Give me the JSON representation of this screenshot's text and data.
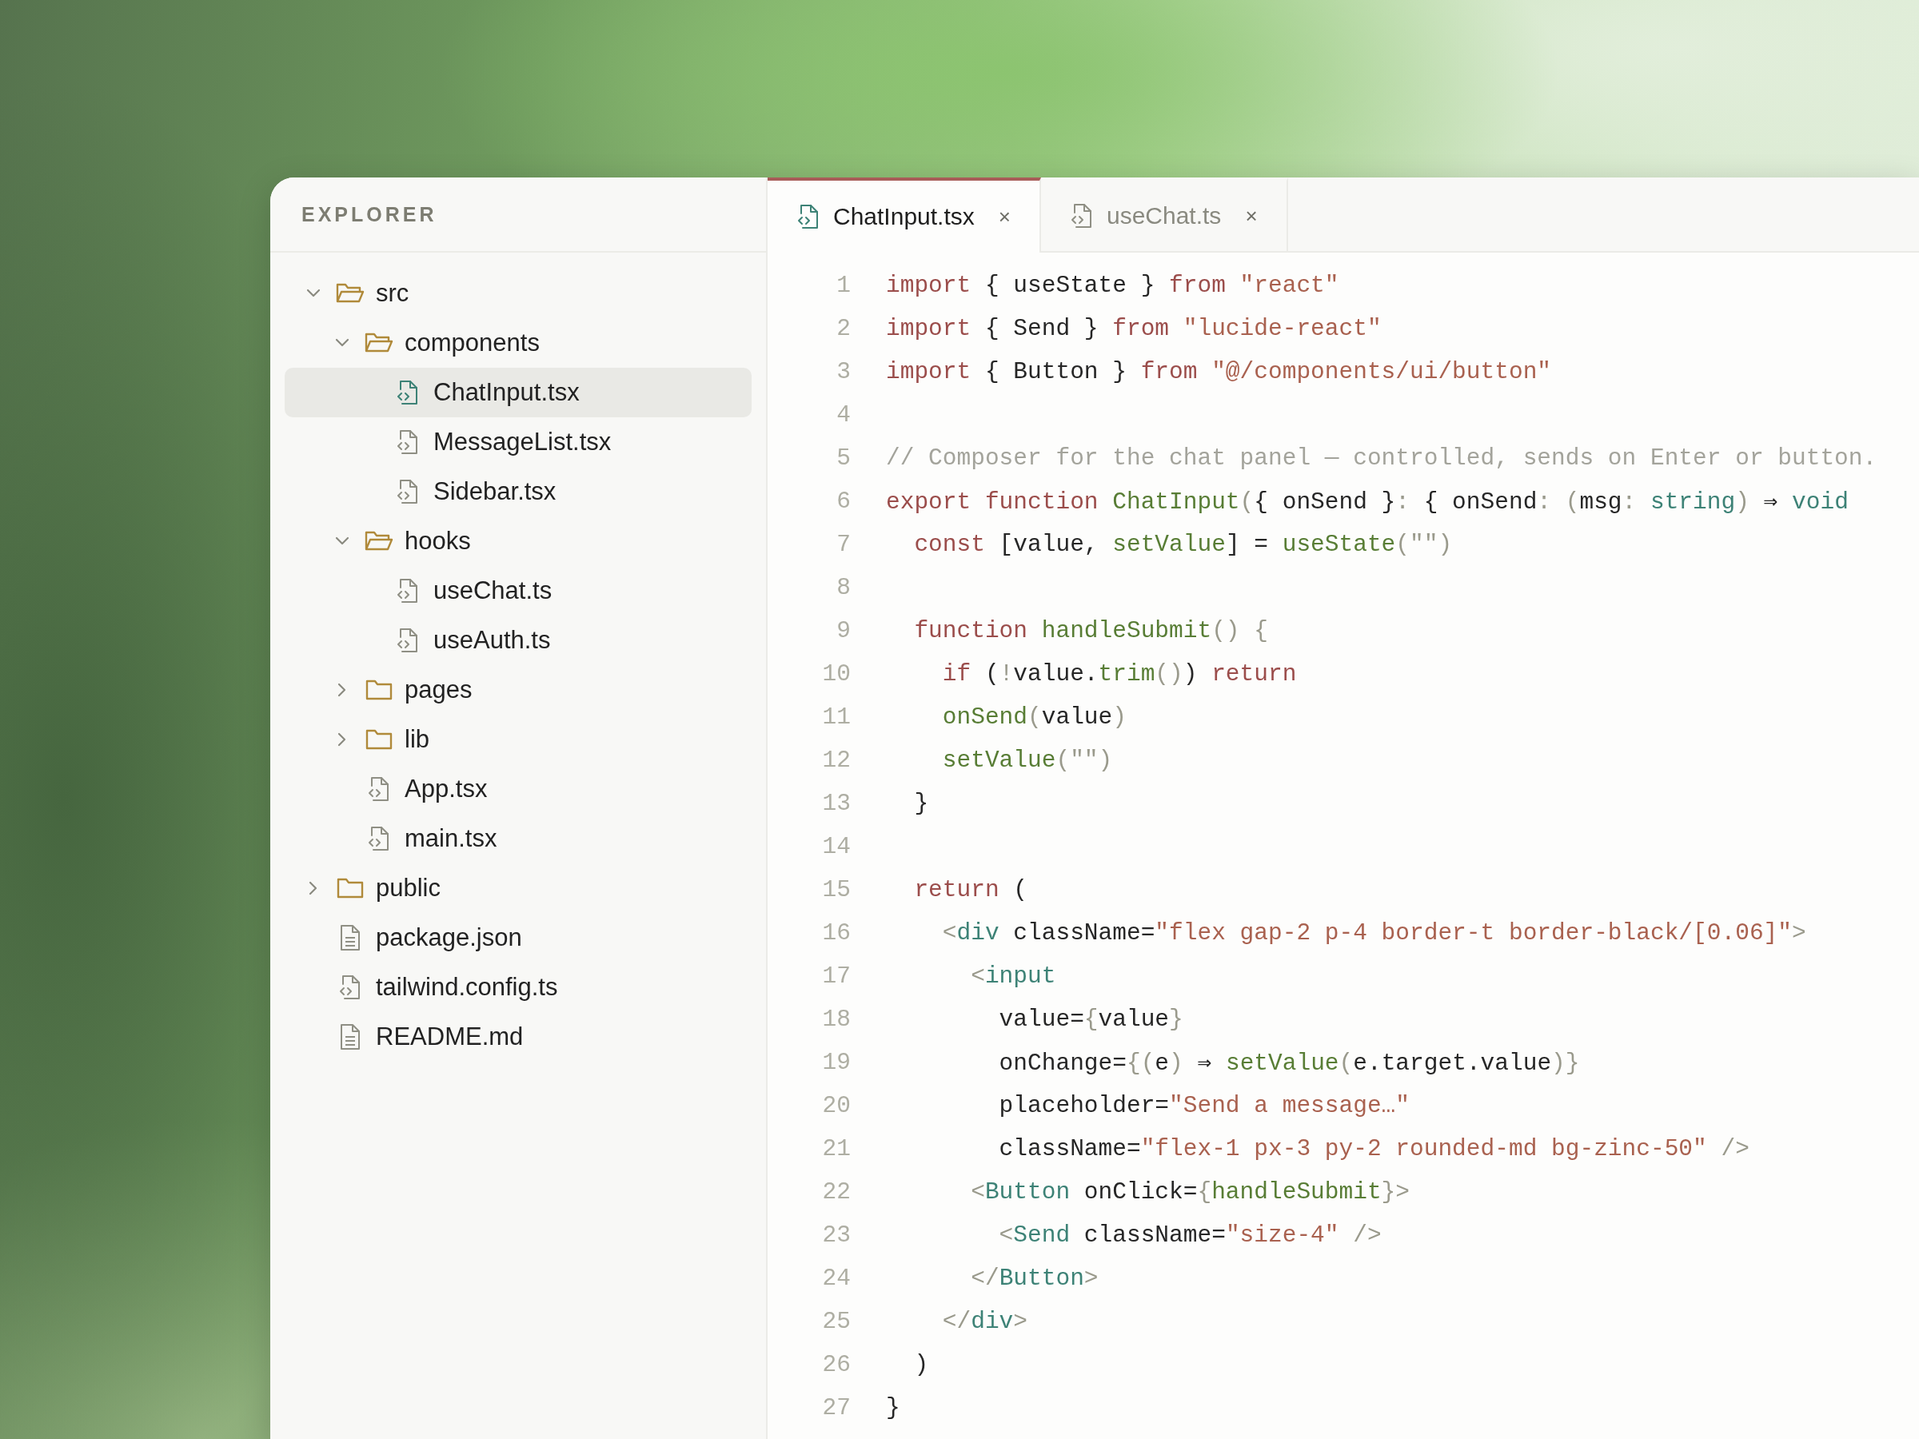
{
  "sidebar": {
    "title": "EXPLORER",
    "tree": [
      {
        "label": "src",
        "kind": "folder",
        "expanded": true,
        "selected": false,
        "children": [
          {
            "label": "components",
            "kind": "folder",
            "expanded": true,
            "selected": false,
            "children": [
              {
                "label": "ChatInput.tsx",
                "kind": "code",
                "selected": true
              },
              {
                "label": "MessageList.tsx",
                "kind": "code",
                "selected": false
              },
              {
                "label": "Sidebar.tsx",
                "kind": "code",
                "selected": false
              }
            ]
          },
          {
            "label": "hooks",
            "kind": "folder",
            "expanded": true,
            "selected": false,
            "children": [
              {
                "label": "useChat.ts",
                "kind": "code",
                "selected": false
              },
              {
                "label": "useAuth.ts",
                "kind": "code",
                "selected": false
              }
            ]
          },
          {
            "label": "pages",
            "kind": "folder",
            "expanded": false,
            "selected": false
          },
          {
            "label": "lib",
            "kind": "folder",
            "expanded": false,
            "selected": false
          },
          {
            "label": "App.tsx",
            "kind": "code",
            "selected": false
          },
          {
            "label": "main.tsx",
            "kind": "code",
            "selected": false
          }
        ]
      },
      {
        "label": "public",
        "kind": "folder",
        "expanded": false,
        "selected": false
      },
      {
        "label": "package.json",
        "kind": "text",
        "selected": false
      },
      {
        "label": "tailwind.config.ts",
        "kind": "code",
        "selected": false
      },
      {
        "label": "README.md",
        "kind": "text",
        "selected": false
      }
    ]
  },
  "tabs": [
    {
      "label": "ChatInput.tsx",
      "close": "×",
      "selected": true
    },
    {
      "label": "useChat.ts",
      "close": "×",
      "selected": false
    }
  ],
  "editor": {
    "lines": [
      {
        "number": "1",
        "tokens": [
          {
            "kind": "keyword",
            "text": "import"
          },
          {
            "kind": "plain",
            "text": " { useState } "
          },
          {
            "kind": "keyword",
            "text": "from"
          },
          {
            "kind": "string",
            "text": " \"react\""
          }
        ]
      },
      {
        "number": "2",
        "tokens": [
          {
            "kind": "keyword",
            "text": "import"
          },
          {
            "kind": "plain",
            "text": " { Send } "
          },
          {
            "kind": "keyword",
            "text": "from"
          },
          {
            "kind": "string",
            "text": " \"lucide-react\""
          }
        ]
      },
      {
        "number": "3",
        "tokens": [
          {
            "kind": "keyword",
            "text": "import"
          },
          {
            "kind": "plain",
            "text": " { Button } "
          },
          {
            "kind": "keyword",
            "text": "from"
          },
          {
            "kind": "string",
            "text": " \"@/components/ui/button\""
          }
        ]
      },
      {
        "number": "4"
      },
      {
        "number": "5",
        "tokens": [
          {
            "kind": "comment",
            "text": "// Composer for the chat panel — controlled, sends on Enter or button."
          }
        ]
      },
      {
        "number": "6",
        "tokens": [
          {
            "kind": "keyword",
            "text": "export function "
          },
          {
            "kind": "function",
            "text": "ChatInput"
          },
          {
            "kind": "punct",
            "text": "("
          },
          {
            "kind": "plain",
            "text": "{ onSend }"
          },
          {
            "kind": "punct",
            "text": ": "
          },
          {
            "kind": "plain",
            "text": "{ onSend"
          },
          {
            "kind": "punct",
            "text": ": ("
          },
          {
            "kind": "plain",
            "text": "msg"
          },
          {
            "kind": "punct",
            "text": ": "
          },
          {
            "kind": "type",
            "text": "string"
          },
          {
            "kind": "punct",
            "text": ") "
          },
          {
            "kind": "plain",
            "text": "⇒ "
          },
          {
            "kind": "type",
            "text": "void"
          }
        ]
      },
      {
        "number": "7",
        "tokens": [
          {
            "kind": "keyword",
            "text": "  const"
          },
          {
            "kind": "plain",
            "text": " [value, "
          },
          {
            "kind": "function",
            "text": "setValue"
          },
          {
            "kind": "plain",
            "text": "] = "
          },
          {
            "kind": "function",
            "text": "useState"
          },
          {
            "kind": "punct",
            "text": "(\"\")"
          }
        ]
      },
      {
        "number": "8"
      },
      {
        "number": "9",
        "tokens": [
          {
            "kind": "keyword",
            "text": "  function "
          },
          {
            "kind": "function",
            "text": "handleSubmit"
          },
          {
            "kind": "punct",
            "text": "() {"
          }
        ]
      },
      {
        "number": "10",
        "tokens": [
          {
            "kind": "keyword",
            "text": "    if"
          },
          {
            "kind": "plain",
            "text": " ("
          },
          {
            "kind": "punct",
            "text": "!"
          },
          {
            "kind": "plain",
            "text": "value."
          },
          {
            "kind": "function",
            "text": "trim"
          },
          {
            "kind": "punct",
            "text": "()"
          },
          {
            "kind": "plain",
            "text": ") "
          },
          {
            "kind": "keyword",
            "text": "return"
          }
        ]
      },
      {
        "number": "11",
        "tokens": [
          {
            "kind": "function",
            "text": "    onSend"
          },
          {
            "kind": "punct",
            "text": "("
          },
          {
            "kind": "plain",
            "text": "value"
          },
          {
            "kind": "punct",
            "text": ")"
          }
        ]
      },
      {
        "number": "12",
        "tokens": [
          {
            "kind": "function",
            "text": "    setValue"
          },
          {
            "kind": "punct",
            "text": "(\"\")"
          }
        ]
      },
      {
        "number": "13",
        "tokens": [
          {
            "kind": "plain",
            "text": "  }"
          }
        ]
      },
      {
        "number": "14"
      },
      {
        "number": "15",
        "tokens": [
          {
            "kind": "keyword",
            "text": "  return"
          },
          {
            "kind": "plain",
            "text": " ("
          }
        ]
      },
      {
        "number": "16",
        "tokens": [
          {
            "kind": "punct",
            "text": "    <"
          },
          {
            "kind": "tag",
            "text": "div"
          },
          {
            "kind": "plain",
            "text": " className="
          },
          {
            "kind": "string",
            "text": "\"flex gap-2 p-4 border-t border-black/[0.06]\""
          },
          {
            "kind": "punct",
            "text": ">"
          }
        ]
      },
      {
        "number": "17",
        "tokens": [
          {
            "kind": "punct",
            "text": "      <"
          },
          {
            "kind": "tag",
            "text": "input"
          }
        ]
      },
      {
        "number": "18",
        "tokens": [
          {
            "kind": "plain",
            "text": "        value="
          },
          {
            "kind": "punct",
            "text": "{"
          },
          {
            "kind": "plain",
            "text": "value"
          },
          {
            "kind": "punct",
            "text": "}"
          }
        ]
      },
      {
        "number": "19",
        "tokens": [
          {
            "kind": "plain",
            "text": "        onChange="
          },
          {
            "kind": "punct",
            "text": "{("
          },
          {
            "kind": "plain",
            "text": "e"
          },
          {
            "kind": "punct",
            "text": ") "
          },
          {
            "kind": "plain",
            "text": "⇒ "
          },
          {
            "kind": "function",
            "text": "setValue"
          },
          {
            "kind": "punct",
            "text": "("
          },
          {
            "kind": "plain",
            "text": "e.target.value"
          },
          {
            "kind": "punct",
            "text": ")}"
          }
        ]
      },
      {
        "number": "20",
        "tokens": [
          {
            "kind": "plain",
            "text": "        placeholder="
          },
          {
            "kind": "string",
            "text": "\"Send a message…\""
          }
        ]
      },
      {
        "number": "21",
        "tokens": [
          {
            "kind": "plain",
            "text": "        className="
          },
          {
            "kind": "string",
            "text": "\"flex-1 px-3 py-2 rounded-md bg-zinc-50\""
          },
          {
            "kind": "punct",
            "text": " />"
          }
        ]
      },
      {
        "number": "22",
        "tokens": [
          {
            "kind": "punct",
            "text": "      <"
          },
          {
            "kind": "tag",
            "text": "Button"
          },
          {
            "kind": "plain",
            "text": " onClick="
          },
          {
            "kind": "punct",
            "text": "{"
          },
          {
            "kind": "function",
            "text": "handleSubmit"
          },
          {
            "kind": "punct",
            "text": "}>"
          }
        ]
      },
      {
        "number": "23",
        "tokens": [
          {
            "kind": "punct",
            "text": "        <"
          },
          {
            "kind": "tag",
            "text": "Send"
          },
          {
            "kind": "plain",
            "text": " className="
          },
          {
            "kind": "string",
            "text": "\"size-4\""
          },
          {
            "kind": "punct",
            "text": " />"
          }
        ]
      },
      {
        "number": "24",
        "tokens": [
          {
            "kind": "punct",
            "text": "      </"
          },
          {
            "kind": "tag",
            "text": "Button"
          },
          {
            "kind": "punct",
            "text": ">"
          }
        ]
      },
      {
        "number": "25",
        "tokens": [
          {
            "kind": "punct",
            "text": "    </"
          },
          {
            "kind": "tag",
            "text": "div"
          },
          {
            "kind": "punct",
            "text": ">"
          }
        ]
      },
      {
        "number": "26",
        "tokens": [
          {
            "kind": "plain",
            "text": "  )"
          }
        ]
      },
      {
        "number": "27",
        "tokens": [
          {
            "kind": "plain",
            "text": "}"
          }
        ]
      }
    ]
  }
}
